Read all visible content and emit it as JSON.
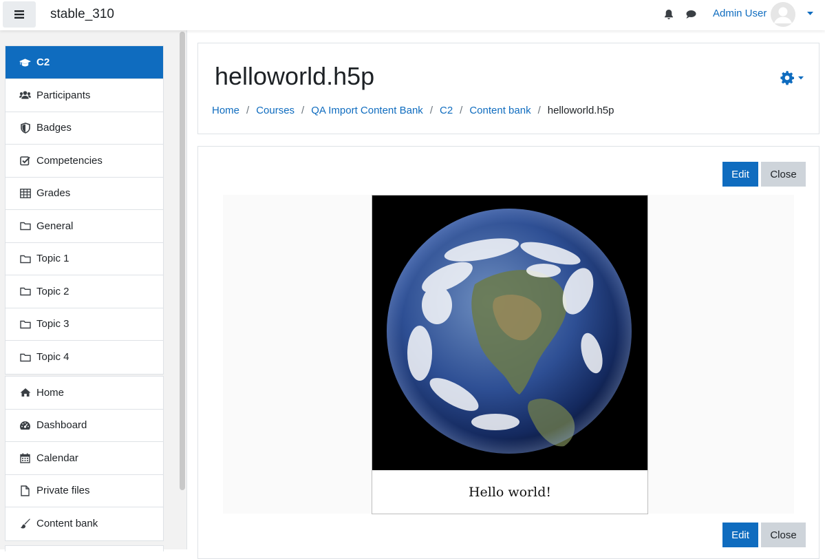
{
  "navbar": {
    "site_name": "stable_310",
    "user_name": "Admin User"
  },
  "drawer": {
    "course_items": [
      {
        "label": "C2",
        "icon": "graduation-cap-icon",
        "active": true
      },
      {
        "label": "Participants",
        "icon": "users-icon"
      },
      {
        "label": "Badges",
        "icon": "shield-icon"
      },
      {
        "label": "Competencies",
        "icon": "check-square-icon"
      },
      {
        "label": "Grades",
        "icon": "table-icon"
      },
      {
        "label": "General",
        "icon": "folder-icon"
      },
      {
        "label": "Topic 1",
        "icon": "folder-icon"
      },
      {
        "label": "Topic 2",
        "icon": "folder-icon"
      },
      {
        "label": "Topic 3",
        "icon": "folder-icon"
      },
      {
        "label": "Topic 4",
        "icon": "folder-icon"
      }
    ],
    "site_items": [
      {
        "label": "Home",
        "icon": "home-icon"
      },
      {
        "label": "Dashboard",
        "icon": "dashboard-icon"
      },
      {
        "label": "Calendar",
        "icon": "calendar-icon"
      },
      {
        "label": "Private files",
        "icon": "file-icon"
      },
      {
        "label": "Content bank",
        "icon": "brush-icon"
      }
    ]
  },
  "header": {
    "title": "helloworld.h5p",
    "breadcrumb": [
      "Home",
      "Courses",
      "QA Import Content Bank",
      "C2",
      "Content bank"
    ],
    "breadcrumb_current": "helloworld.h5p"
  },
  "content": {
    "edit_label": "Edit",
    "close_label": "Close",
    "caption": "Hello world!"
  },
  "colors": {
    "accent": "#0f6cbf",
    "secondary_button": "#ced4da"
  }
}
